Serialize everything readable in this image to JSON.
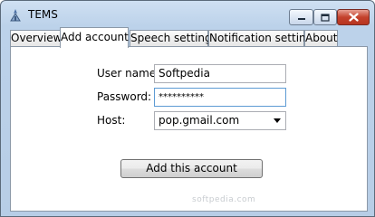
{
  "window": {
    "title": "TEMS"
  },
  "tabs": [
    {
      "label": "Overview"
    },
    {
      "label": "Add account"
    },
    {
      "label": "Speech settings"
    },
    {
      "label": "Notification settings"
    },
    {
      "label": "About"
    }
  ],
  "form": {
    "username_label": "User name:",
    "username_value": "Softpedia",
    "password_label": "Password:",
    "password_value": "**********",
    "host_label": "Host:",
    "host_value": "pop.gmail.com"
  },
  "add_button_label": "Add this account",
  "watermark": "softpedia.com",
  "icons": {
    "app": "tems-app-icon",
    "minimize": "minimize-icon",
    "maximize": "maximize-icon",
    "close": "close-icon",
    "dropdown": "chevron-down-icon"
  },
  "colors": {
    "titlebar": "#bcd2ea",
    "close_button": "#c4412c",
    "focus_border": "#5d9bd4"
  }
}
